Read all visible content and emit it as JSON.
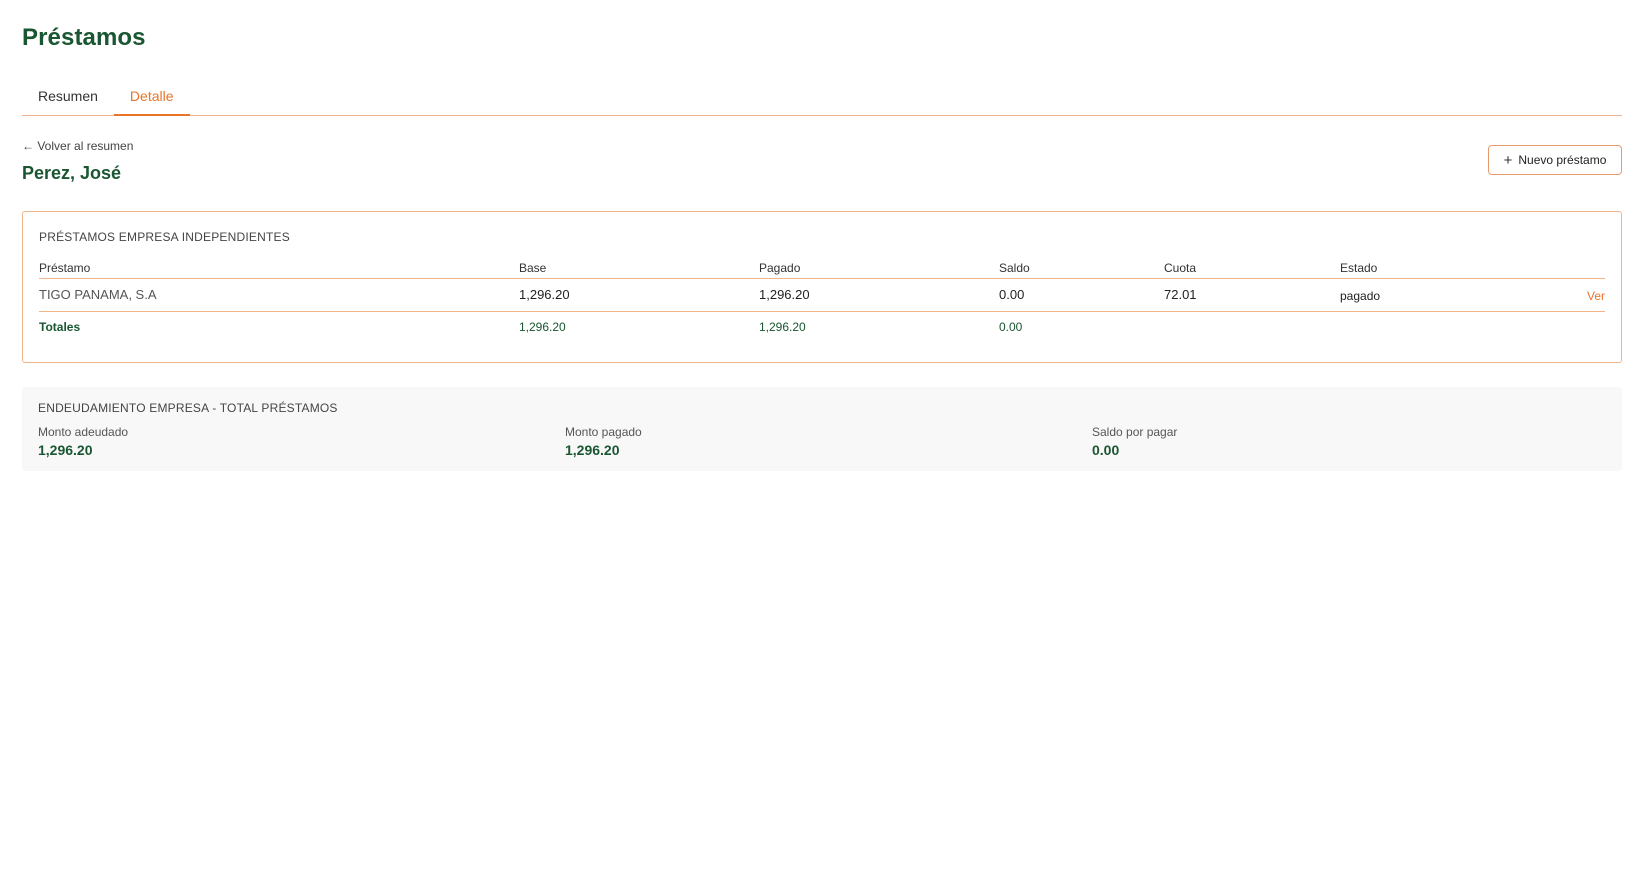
{
  "page": {
    "title": "Préstamos"
  },
  "tabs": [
    {
      "label": "Resumen",
      "active": false
    },
    {
      "label": "Detalle",
      "active": true
    }
  ],
  "detail": {
    "back_link": "← Volver al resumen",
    "client_name": "Perez, José",
    "new_loan_button": "Nuevo préstamo"
  },
  "loans_table": {
    "title": "PRÉSTAMOS EMPRESA INDEPENDIENTES",
    "columns": [
      "Préstamo",
      "Base",
      "Pagado",
      "Saldo",
      "Cuota",
      "Estado"
    ],
    "rows": [
      {
        "lender": "TIGO PANAMA, S.A",
        "base": "1,296.20",
        "paid": "1,296.20",
        "balance": "0.00",
        "installment": "72.01",
        "status": "pagado",
        "action": "Ver"
      }
    ],
    "totals": {
      "label": "Totales",
      "base": "1,296.20",
      "paid": "1,296.20",
      "balance": "0.00"
    }
  },
  "summary": {
    "title": "ENDEUDAMIENTO EMPRESA - TOTAL PRÉSTAMOS",
    "metrics": [
      {
        "label": "Monto adeudado",
        "value": "1,296.20"
      },
      {
        "label": "Monto pagado",
        "value": "1,296.20"
      },
      {
        "label": "Saldo por pagar",
        "value": "0.00"
      }
    ]
  },
  "colors": {
    "brand_green": "#1a5632",
    "accent_orange": "#e9742a",
    "border_orange": "#f3b48c"
  },
  "icons": {
    "new_loan": "plus-icon"
  }
}
